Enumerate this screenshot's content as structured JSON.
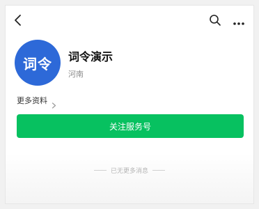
{
  "header": {
    "back_icon": "chevron-left-icon",
    "search_icon": "search-icon",
    "more_icon": "more-dots-icon"
  },
  "account": {
    "avatar_text": "词令",
    "name": "词令演示",
    "region": "河南",
    "avatar_color": "#2d69d8"
  },
  "more_info": {
    "label": "更多资料"
  },
  "actions": {
    "follow_label": "关注服务号",
    "follow_color": "#07c160"
  },
  "footer": {
    "no_more_text": "已无更多消息"
  }
}
